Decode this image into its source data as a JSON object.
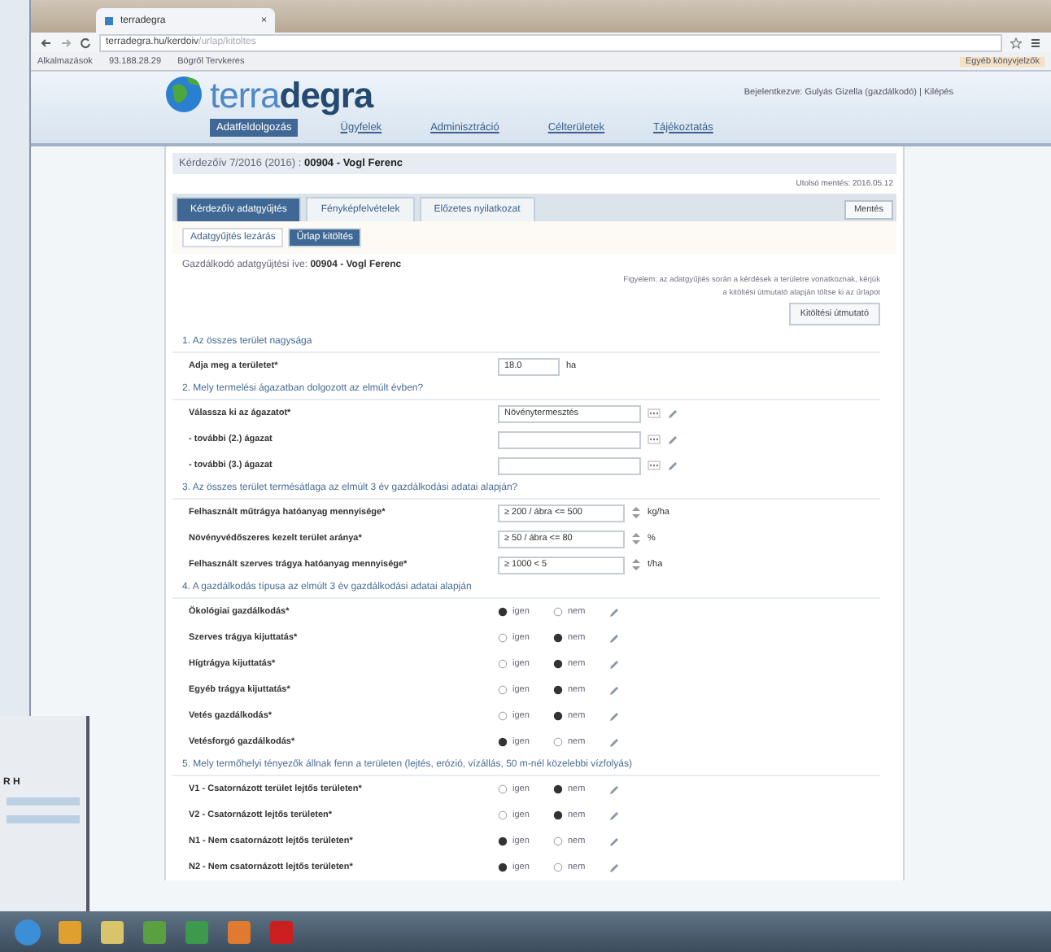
{
  "browser": {
    "tab_title": "terradegra",
    "tab_close": "×",
    "address": "terradegra.hu/kerdoiv",
    "address_path": "/urlap/kitoltes",
    "bookmarks": [
      "Alkalmazások",
      "93.188.28.29",
      "Bögről Tervkeres"
    ],
    "bookmarks_right": "Egyéb könyvjelzők"
  },
  "background_window": {
    "text": "R H"
  },
  "site": {
    "logo_light": "terra",
    "logo_bold": "degra",
    "user_text": "Bejelentkezve: Gulyás Gizella (gazdálkodó) | Kilépés",
    "nav": [
      {
        "label": "Adatfeldolgozás",
        "selected": true
      },
      {
        "label": "Ügyfelek",
        "selected": false
      },
      {
        "label": "Adminisztráció",
        "selected": false
      },
      {
        "label": "Célterületek",
        "selected": false
      },
      {
        "label": "Tájékoztatás",
        "selected": false
      }
    ]
  },
  "page": {
    "title": "Kérdezőív 7/2016 (2016) :",
    "title_bold": "00904 - Vogl Ferenc",
    "info": "Utolsó mentés: 2016.05.12",
    "save_button": "Mentés",
    "tabs": [
      {
        "label": "Kérdezőív adatgyűjtés",
        "selected": true
      },
      {
        "label": "Fényképfelvételek",
        "selected": false
      },
      {
        "label": "Előzetes nyilatkozat",
        "selected": false
      }
    ],
    "subtabs": [
      {
        "label": "Adatgyűjtés lezárás",
        "selected": false
      },
      {
        "label": "Űrlap kitöltés",
        "selected": true
      }
    ],
    "owner_label": "Gazdálkodó adatgyűjtési íve:",
    "owner_value": "00904 - Vogl Ferenc",
    "note": [
      "Figyelem: az adatgyűjtés során a kérdések a területre vonatkoznak, kérjük",
      "a kitöltési útmutató alapján töltse ki az űrlapot"
    ],
    "note_button": "Kitöltési útmutató"
  },
  "sections": [
    {
      "title": "1. Az összes terület nagysága",
      "rows": [
        {
          "kind": "input",
          "label": "Adja meg a területet*",
          "value": "18.0",
          "unit": "ha"
        }
      ]
    },
    {
      "title": "2. Mely termelési ágazatban dolgozott az elmúlt évben?",
      "rows": [
        {
          "kind": "select",
          "label": "Válassza ki az ágazatot*",
          "value": "Növénytermesztés"
        },
        {
          "kind": "select",
          "label": "- további (2.) ágazat",
          "value": ""
        },
        {
          "kind": "select",
          "label": "- további (3.) ágazat",
          "value": ""
        }
      ]
    },
    {
      "title": "3. Az összes terület termésátlaga az elmúlt 3 év gazdálkodási adatai alapján?",
      "rows": [
        {
          "kind": "input",
          "label": "Felhasznált műtrágya hatóanyag mennyisége*",
          "value": "≥ 200 / ábra <= 500",
          "unit": "kg/ha"
        },
        {
          "kind": "input",
          "label": "Növényvédőszeres kezelt terület aránya*",
          "value": "≥ 50 / ábra <= 80",
          "unit": "%"
        },
        {
          "kind": "input",
          "label": "Felhasznált szerves trágya hatóanyag mennyisége*",
          "value": "≥ 1000 < 5",
          "unit": "t/ha"
        }
      ]
    },
    {
      "title": "4. A gazdálkodás típusa az elmúlt 3 év gazdálkodási adatai alapján",
      "rows": [
        {
          "kind": "radio",
          "label": "Ökológiai gazdálkodás*",
          "options": [
            {
              "label": "igen",
              "selected": true
            },
            {
              "label": "nem",
              "selected": false
            }
          ]
        },
        {
          "kind": "radio",
          "label": "Szerves trágya kijuttatás*",
          "options": [
            {
              "label": "igen",
              "selected": false
            },
            {
              "label": "nem",
              "selected": true
            }
          ]
        },
        {
          "kind": "radio",
          "label": "Hígtrágya kijuttatás*",
          "options": [
            {
              "label": "igen",
              "selected": false
            },
            {
              "label": "nem",
              "selected": true
            }
          ]
        },
        {
          "kind": "radio",
          "label": "Egyéb trágya kijuttatás*",
          "options": [
            {
              "label": "igen",
              "selected": false
            },
            {
              "label": "nem",
              "selected": true
            }
          ]
        },
        {
          "kind": "radio",
          "label": "Vetés gazdálkodás*",
          "options": [
            {
              "label": "igen",
              "selected": false
            },
            {
              "label": "nem",
              "selected": true
            }
          ]
        },
        {
          "kind": "radio",
          "label": "Vetésforgó gazdálkodás*",
          "options": [
            {
              "label": "igen",
              "selected": true
            },
            {
              "label": "nem",
              "selected": false
            }
          ]
        }
      ]
    },
    {
      "title": "5. Mely termőhelyi tényezők állnak fenn a területen (lejtés, erózió, vízállás, 50 m-nél közelebbi vízfolyás)",
      "rows": [
        {
          "kind": "radio",
          "label": "V1 - Csatornázott terület lejtős területen*",
          "options": [
            {
              "label": "igen",
              "selected": false
            },
            {
              "label": "nem",
              "selected": true
            }
          ]
        },
        {
          "kind": "radio",
          "label": "V2 - Csatornázott lejtős területen*",
          "options": [
            {
              "label": "igen",
              "selected": false
            },
            {
              "label": "nem",
              "selected": true
            }
          ]
        },
        {
          "kind": "radio",
          "label": "N1 - Nem csatornázott lejtős területen*",
          "options": [
            {
              "label": "igen",
              "selected": true
            },
            {
              "label": "nem",
              "selected": false
            }
          ]
        },
        {
          "kind": "radio",
          "label": "N2 - Nem csatornázott lejtős területen*",
          "options": [
            {
              "label": "igen",
              "selected": true
            },
            {
              "label": "nem",
              "selected": false
            }
          ]
        }
      ]
    }
  ]
}
